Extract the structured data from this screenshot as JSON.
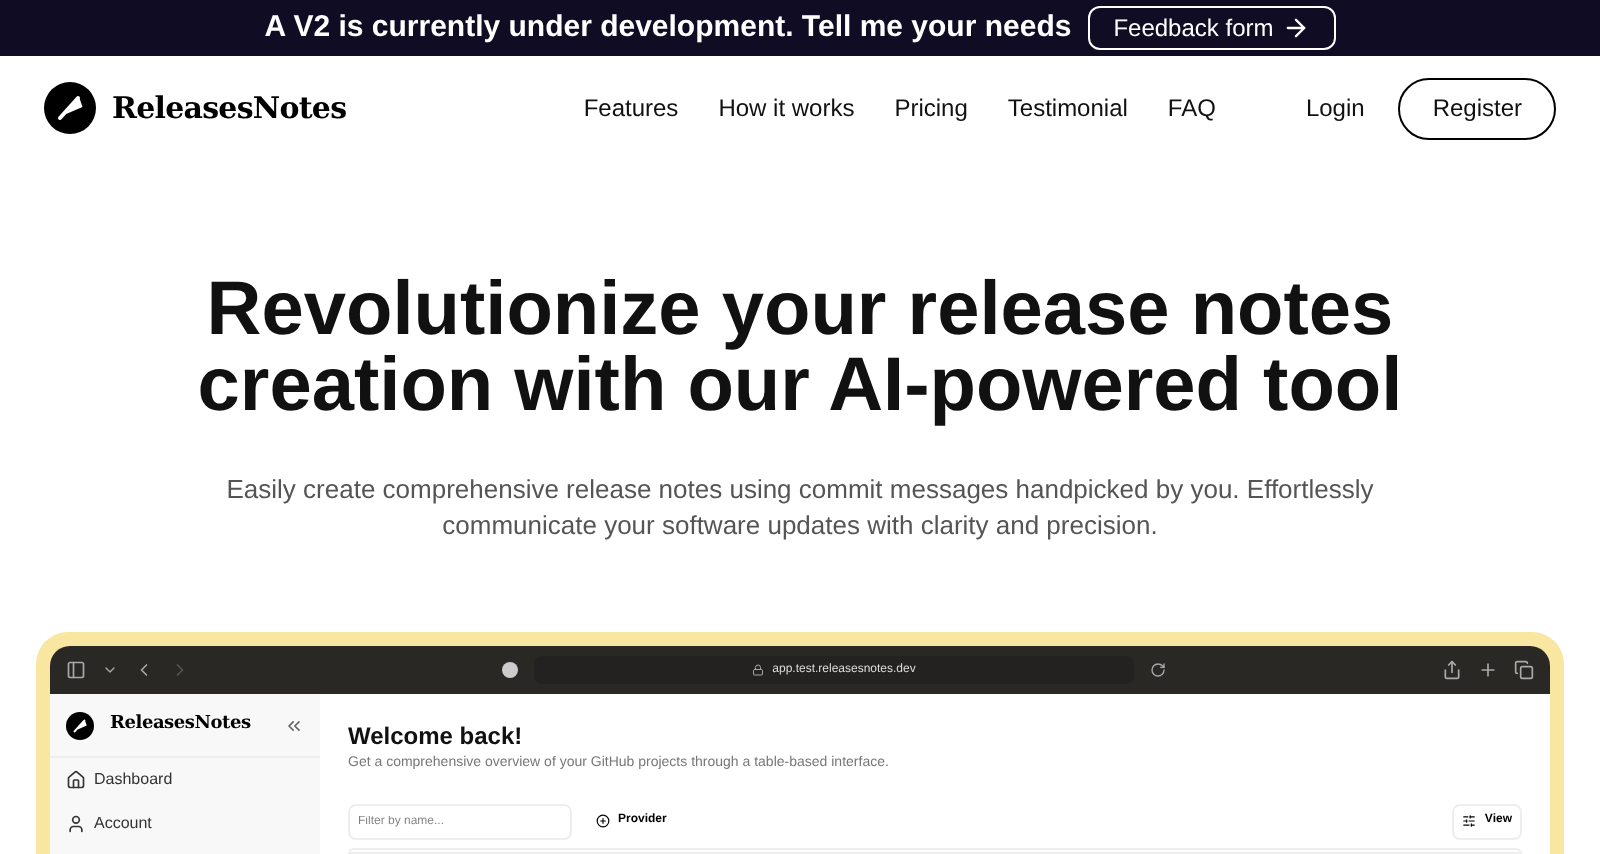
{
  "banner": {
    "text": "A V2 is currently under development. Tell me your needs",
    "button": "Feedback form"
  },
  "header": {
    "logo": "ReleasesNotes",
    "nav": [
      "Features",
      "How it works",
      "Pricing",
      "Testimonial",
      "FAQ"
    ],
    "login": "Login",
    "register": "Register"
  },
  "hero": {
    "title_lines": [
      "Revolutionize your release notes",
      "creation with our AI-powered tool"
    ],
    "subtitle_lines": [
      "Easily create comprehensive release notes using commit messages handpicked by you. Effortlessly",
      "communicate your software updates with clarity and precision."
    ]
  },
  "preview": {
    "url": "app.test.releasesnotes.dev",
    "sidebar": {
      "logo": "ReleasesNotes",
      "items": [
        {
          "label": "Dashboard",
          "kind": "home"
        },
        {
          "label": "Account",
          "kind": "user"
        }
      ]
    },
    "main": {
      "title": "Welcome back!",
      "subtitle": "Get a comprehensive overview of your GitHub projects through a table-based interface.",
      "filter": {
        "placeholder": "Filter by name..."
      },
      "provider": "Provider",
      "view": "View"
    }
  }
}
